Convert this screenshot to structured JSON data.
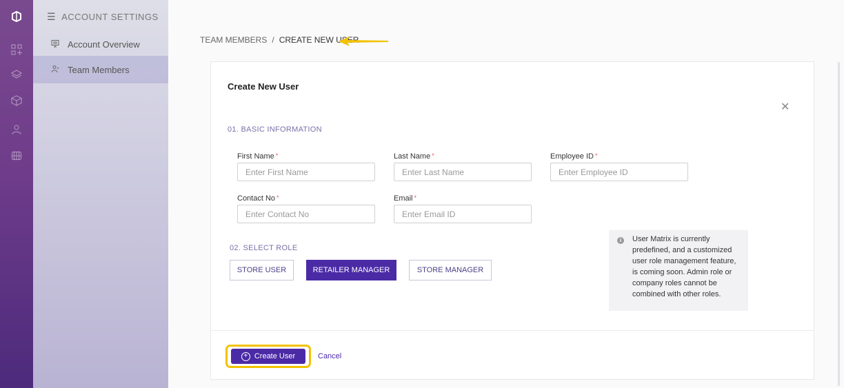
{
  "rail": {
    "icons": [
      "logo-icon",
      "grid-icon",
      "layers-icon",
      "box-icon",
      "user-icon",
      "globe-icon"
    ]
  },
  "sidebar": {
    "header": "ACCOUNT SETTINGS",
    "items": [
      {
        "label": "Account Overview",
        "icon": "monitor-icon",
        "active": false
      },
      {
        "label": "Team Members",
        "icon": "users-icon",
        "active": true
      }
    ]
  },
  "breadcrumb": {
    "parent": "TEAM MEMBERS",
    "separator": "/",
    "current": "CREATE NEW USER"
  },
  "form": {
    "title": "Create New User",
    "section1": "01. BASIC INFORMATION",
    "fields": {
      "first_name": {
        "label": "First Name",
        "placeholder": "Enter First Name",
        "value": ""
      },
      "last_name": {
        "label": "Last Name",
        "placeholder": "Enter Last Name",
        "value": ""
      },
      "employee_id": {
        "label": "Employee ID",
        "placeholder": "Enter Employee ID",
        "value": ""
      },
      "contact_no": {
        "label": "Contact No",
        "placeholder": "Enter Contact No",
        "value": ""
      },
      "email": {
        "label": "Email",
        "placeholder": "Enter Email ID",
        "value": ""
      }
    },
    "required_mark": "*",
    "section2": "02. SELECT ROLE",
    "roles": [
      {
        "label": "STORE USER",
        "selected": false
      },
      {
        "label": "RETAILER MANAGER",
        "selected": true
      },
      {
        "label": "STORE MANAGER",
        "selected": false
      }
    ],
    "info_icon": "i",
    "info_text": "User Matrix is currently predefined, and a customized user role management feature, is coming soon. Admin role or company roles cannot be combined with other roles.",
    "create_label": "Create User",
    "cancel_label": "Cancel"
  },
  "colors": {
    "accent": "#4b2aa6",
    "highlight": "#f2c200",
    "required": "#e55555"
  }
}
